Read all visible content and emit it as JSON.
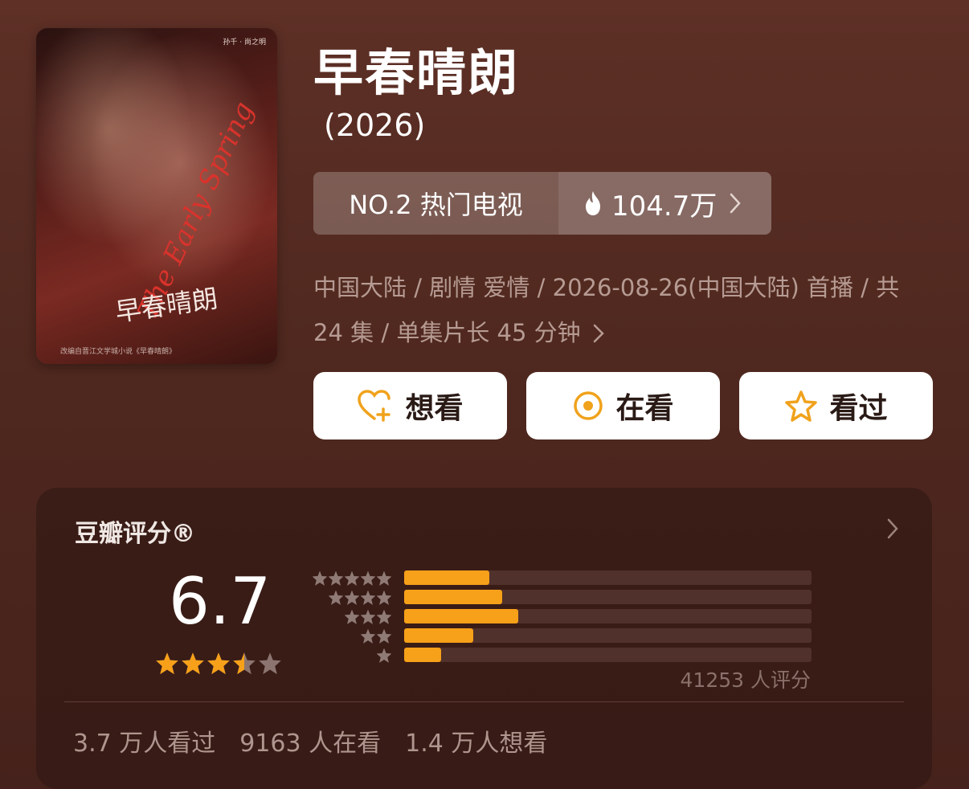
{
  "poster": {
    "title_en": "The Early Spring",
    "title_cn": "早春晴朗",
    "credits": "改编自晋江文学城小说《早春晴朗》",
    "credit_top": "孙千 · 尚之明"
  },
  "title": "早春晴朗",
  "year": "(2026)",
  "rank": {
    "label": "NO.2 热门电视",
    "heat": "104.7万"
  },
  "meta": "中国大陆 / 剧情 爱情 / 2026-08-26(中国大陆) 首播 / 共 24 集 / 单集片长 45 分钟",
  "buttons": {
    "want": "想看",
    "watching": "在看",
    "watched": "看过"
  },
  "rating": {
    "title": "豆瓣评分®",
    "score": "6.7",
    "stars": 3.5,
    "count": "41253 人评分",
    "distribution": [
      {
        "stars": 5,
        "fraction": 0.21
      },
      {
        "stars": 4,
        "fraction": 0.24
      },
      {
        "stars": 3,
        "fraction": 0.28
      },
      {
        "stars": 2,
        "fraction": 0.17
      },
      {
        "stars": 1,
        "fraction": 0.09
      }
    ]
  },
  "stats": {
    "watched": "3.7 万人看过",
    "watching": "9163 人在看",
    "want": "1.4 万人想看"
  },
  "colors": {
    "accent": "#f7a019",
    "background": "#5e3026"
  }
}
